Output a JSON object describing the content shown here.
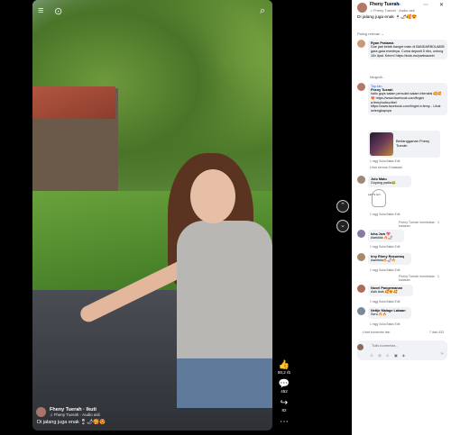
{
  "video": {
    "top_left_icons": [
      "≡",
      "⊙"
    ],
    "top_right_icon": "⌕",
    "creator_name": "Fheny Tuerah · Ikuti",
    "creator_audio": "♫ Fheny Tuerah · Audio asli",
    "caption": "Di jalang juga enak 🍷🌶🥰😍",
    "actions": [
      {
        "icon": "👍",
        "count": "80,2 rb"
      },
      {
        "icon": "💬",
        "count": "452"
      },
      {
        "icon": "↪",
        "count": "82"
      },
      {
        "icon": "⋯",
        "count": ""
      }
    ]
  },
  "nav": {
    "up": "⌃",
    "down": "⌄"
  },
  "panel": {
    "name": "Fheny Tuerah",
    "follow": "· Ikuti",
    "audio": "♫ Fheny Tuerah · Audio asli",
    "caption": "Di jalang juga enak 🍷🌶🥰😍",
    "dots": "⋯",
    "close": "✕",
    "sort": "Paling relevan ⌄",
    "comments": [
      {
        "name": "Ryan Pratama",
        "text": "Gue jadi betah banget main di BANDARBOLA855 gara-gara eventnya. Cuma deposit 5 ribu, untung 10x lipat. Keren! https://bola.mx/partnaowin",
        "meta": "Mengedit..."
      },
      {
        "name": "Fheny Tuerah",
        "text": "hallo guys salam pemulah salam interaksi 🥰🥰😍 https://www.facebook.com/fingini a.femy/subscribe/ https://www.facebook.com/fingini a.femy... Lihat selengkapnya",
        "meta": "1 mgg  Suka  Balas  Edit"
      },
      {
        "name": "Jolo Matu",
        "text": "Goyang padia😂",
        "meta": "1 mgg  Suka  Balas  Edit"
      },
      {
        "name": "Icha Jow 💖",
        "text": "Asekkkk 🔥🌶",
        "meta": "1 mgg  Suka  Balas  Edit"
      },
      {
        "name": "Irny Rinny Rosumaq",
        "text": "Aseekkk🔥🌶🔥",
        "meta": "1 mgg  Suka  Balas  Edit"
      },
      {
        "name": "Novel Pangemanan",
        "text": "Asik Asik 🥰😍🥰",
        "meta": "1 mgg  Suka  Balas  Edit"
      },
      {
        "name": "Nettje Malage Lakaan",
        "text": "Seru 🔥🔥",
        "meta": "1 mgg  Suka  Balas  Edit"
      }
    ],
    "top_fan": "Top fan",
    "subscribe_card": "Berlangganan Fheny Tuerah",
    "view_replies_1": "Lihat semua 9 balasan",
    "replied_1": "Fheny Tuerah membalas · 1 balasan",
    "replied_2": "Fheny Tuerah membalas · 1 balasan",
    "sticker_text": "LET'S GO",
    "more": "Lihat komentar lain",
    "pages": "7 dari 433",
    "input_placeholder": "Tulis komentar...",
    "input_icons": "☺ ◎ ☺ ▣ ◈",
    "send": "➤"
  }
}
